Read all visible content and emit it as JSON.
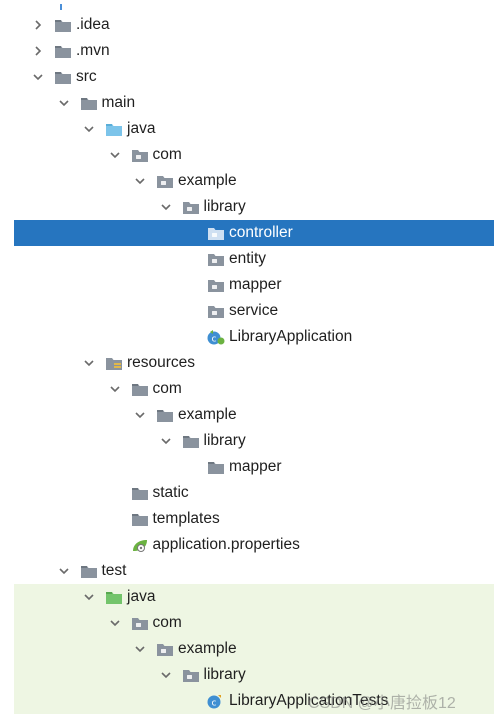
{
  "tree": [
    {
      "id": "idea",
      "label": ".idea",
      "depth": 0,
      "state": "collapsed",
      "icon": "folder-icon"
    },
    {
      "id": "mvn",
      "label": ".mvn",
      "depth": 0,
      "state": "collapsed",
      "icon": "folder-icon"
    },
    {
      "id": "src",
      "label": "src",
      "depth": 0,
      "state": "expanded",
      "icon": "folder-icon"
    },
    {
      "id": "main",
      "label": "main",
      "depth": 1,
      "state": "expanded",
      "icon": "folder-icon"
    },
    {
      "id": "main-java",
      "label": "java",
      "depth": 2,
      "state": "expanded",
      "icon": "source-root-folder-icon"
    },
    {
      "id": "main-com",
      "label": "com",
      "depth": 3,
      "state": "expanded",
      "icon": "package-icon"
    },
    {
      "id": "main-example",
      "label": "example",
      "depth": 4,
      "state": "expanded",
      "icon": "package-icon"
    },
    {
      "id": "main-library",
      "label": "library",
      "depth": 5,
      "state": "expanded",
      "icon": "package-icon"
    },
    {
      "id": "controller",
      "label": "controller",
      "depth": 6,
      "state": "leaf",
      "icon": "package-icon",
      "selected": true
    },
    {
      "id": "entity",
      "label": "entity",
      "depth": 6,
      "state": "leaf",
      "icon": "package-icon"
    },
    {
      "id": "mapper",
      "label": "mapper",
      "depth": 6,
      "state": "leaf",
      "icon": "package-icon"
    },
    {
      "id": "service",
      "label": "service",
      "depth": 6,
      "state": "leaf",
      "icon": "package-icon"
    },
    {
      "id": "library-app",
      "label": "LibraryApplication",
      "depth": 6,
      "state": "leaf",
      "icon": "spring-boot-class-icon"
    },
    {
      "id": "resources",
      "label": "resources",
      "depth": 2,
      "state": "expanded",
      "icon": "resources-folder-icon"
    },
    {
      "id": "res-com",
      "label": "com",
      "depth": 3,
      "state": "expanded",
      "icon": "folder-icon"
    },
    {
      "id": "res-example",
      "label": "example",
      "depth": 4,
      "state": "expanded",
      "icon": "folder-icon"
    },
    {
      "id": "res-library",
      "label": "library",
      "depth": 5,
      "state": "expanded",
      "icon": "folder-icon"
    },
    {
      "id": "res-mapper",
      "label": "mapper",
      "depth": 6,
      "state": "leaf",
      "icon": "folder-icon"
    },
    {
      "id": "static",
      "label": "static",
      "depth": 3,
      "state": "leaf",
      "icon": "folder-icon"
    },
    {
      "id": "templates",
      "label": "templates",
      "depth": 3,
      "state": "leaf",
      "icon": "folder-icon"
    },
    {
      "id": "app-props",
      "label": "application.properties",
      "depth": 3,
      "state": "leaf",
      "icon": "spring-properties-icon"
    },
    {
      "id": "test",
      "label": "test",
      "depth": 1,
      "state": "expanded",
      "icon": "folder-icon"
    },
    {
      "id": "test-java",
      "label": "java",
      "depth": 2,
      "state": "expanded",
      "icon": "test-root-folder-icon",
      "band": true
    },
    {
      "id": "test-com",
      "label": "com",
      "depth": 3,
      "state": "expanded",
      "icon": "package-icon",
      "band": true
    },
    {
      "id": "test-example",
      "label": "example",
      "depth": 4,
      "state": "expanded",
      "icon": "package-icon",
      "band": true
    },
    {
      "id": "test-library",
      "label": "library",
      "depth": 5,
      "state": "expanded",
      "icon": "package-icon",
      "band": true
    },
    {
      "id": "test-app",
      "label": "LibraryApplicationTests",
      "depth": 6,
      "state": "leaf",
      "icon": "test-class-icon",
      "band": true
    }
  ],
  "watermark": "CSDN @小唐捡板12",
  "colors": {
    "folder": "#8a939e",
    "folder_dark": "#6e7781",
    "source_root": "#7cc4ea",
    "test_root": "#73c46b",
    "selected_bg": "#2675bf",
    "test_band": "#eef6e3",
    "spring": "#6bb241",
    "class_blue": "#3f8fd2"
  }
}
